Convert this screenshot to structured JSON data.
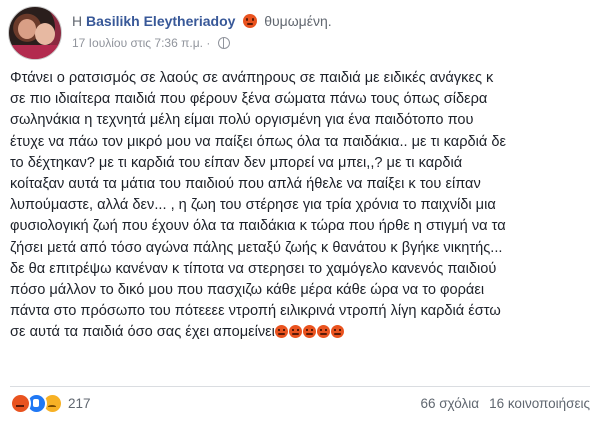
{
  "header": {
    "prefix": "Η",
    "author": "Basilikh Eleytheriadoy",
    "feeling": "θυμωμένη.",
    "timestamp": "17 Ιουλίου στις 7:36 π.μ.",
    "separator": "·",
    "privacy_icon": "globe-icon"
  },
  "post": {
    "lines": [
      "Φτάνει ο ρατσισμός σε λαούς σε ανάπηρους σε παιδιά με ειδικές ανάγκες κ",
      "σε πιο ιδιαίτερα παιδιά που φέρουν ξένα σώματα πάνω τους όπως σίδερα",
      "σωληνάκια η τεχνητά μέλη είμαι πολύ οργισμένη για ένα παιδότοπο που",
      "έτυχε να πάω τον μικρό μου να παίξει όπως όλα τα παιδάκια.. με τι καρδιά δε",
      "το δέχτηκαν? με τι καρδιά του είπαν δεν μπορεί να μπει,,? με τι καρδιά",
      "κοίταξαν αυτά τα μάτια του παιδιού που απλά ήθελε να παίξει κ του είπαν",
      "λυπούμαστε, αλλά δεν... , η ζωη του στέρησε για τρία χρόνια το παιχνίδι μια",
      "φυσιολογική ζωή που έχουν όλα τα παιδάκια κ τώρα που ήρθε η στιγμή να τα",
      "ζήσει μετά από τόσο αγώνα πάλης μεταξύ ζωής κ θανάτου κ βγήκε νικητής...",
      "δε θα επιτρέψω κανέναν κ τίποτα να στερησει το χαμόγελο κανενός παιδιού",
      "πόσο μάλλον το δικό μου που πασχιζω κάθε μέρα κάθε ώρα να το φοράει",
      "πάντα στο πρόσωπο του πότεεεε ντροπή ειλικρινά ντροπή λίγη καρδιά έστω",
      "σε αυτά τα παιδιά όσο σας έχει απομείνει"
    ],
    "trailing_emojis": [
      "angry-emoji",
      "angry-emoji",
      "angry-emoji",
      "angry-emoji",
      "angry-emoji"
    ]
  },
  "footer": {
    "reaction_icons": [
      "angry-icon",
      "like-icon",
      "sad-icon"
    ],
    "reaction_count": "217",
    "comments": "66 σχόλια",
    "shares": "16 κοινοποιήσεις"
  },
  "colors": {
    "author_link": "#385898",
    "angry": "#e9531f",
    "like": "#2078f4",
    "sad": "#f7b125"
  }
}
